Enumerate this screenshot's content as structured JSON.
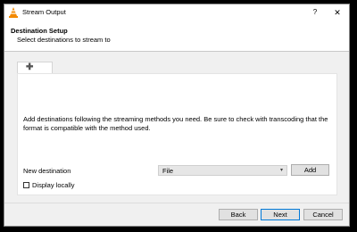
{
  "window": {
    "title": "Stream Output",
    "help_label": "?",
    "close_label": "✕"
  },
  "header": {
    "title": "Destination Setup",
    "subtitle": "Select destinations to stream to"
  },
  "tabs": [
    {
      "icon": "plus-icon",
      "label": "✚"
    }
  ],
  "panel": {
    "info_text": "Add destinations following the streaming methods you need. Be sure to check with transcoding that the format is compatible with the method used.",
    "new_destination_label": "New destination",
    "destination_select": {
      "value": "File",
      "arrow": "▾"
    },
    "add_label": "Add",
    "display_locally_label": "Display locally",
    "display_locally_checked": false
  },
  "footer": {
    "back_label": "Back",
    "next_label": "Next",
    "cancel_label": "Cancel"
  },
  "colors": {
    "vlc_orange": "#f48a00",
    "focus_border": "#0078d7"
  }
}
